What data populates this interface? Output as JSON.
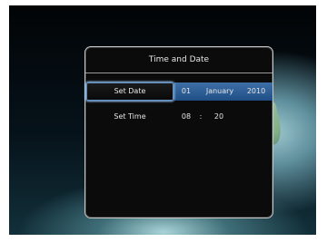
{
  "dialog": {
    "title": "Time and Date"
  },
  "rows": {
    "date": {
      "label": "Set Date",
      "day": "01",
      "month": "January",
      "year": "2010"
    },
    "time": {
      "label": "Set Time",
      "hour": "08",
      "separator": ":",
      "minute": "20"
    }
  },
  "colors": {
    "selection_band": "#2a5b93",
    "selection_border": "#5f8fc4",
    "dialog_bg": "#0b0b0b"
  }
}
